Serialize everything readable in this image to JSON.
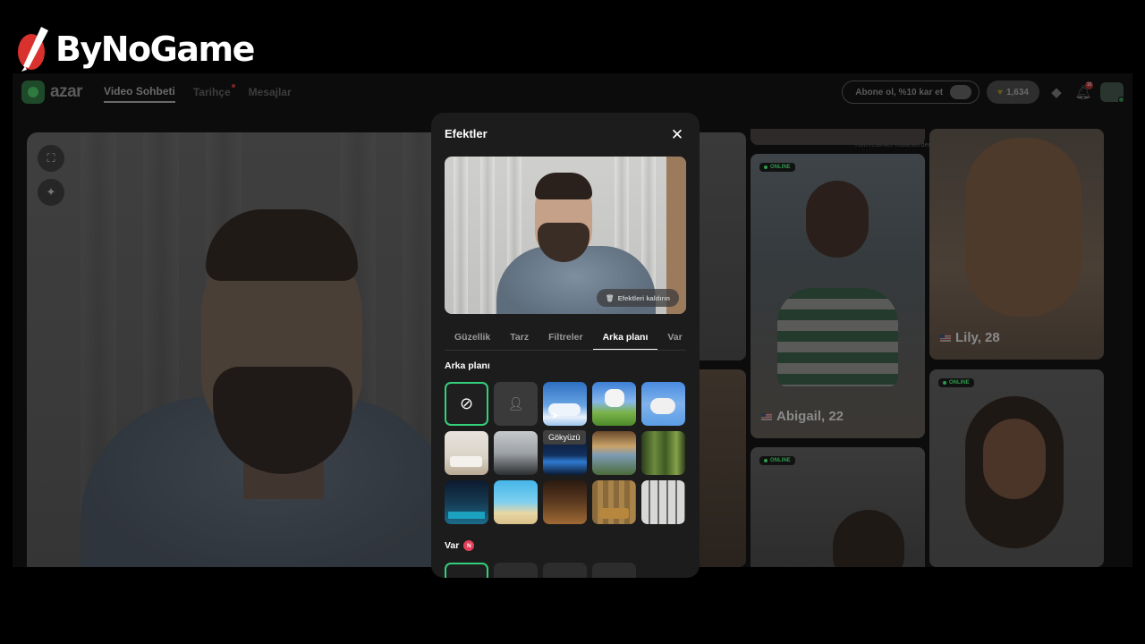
{
  "watermark": {
    "text": "ByNoGame"
  },
  "topbar": {
    "brand": "azar",
    "nav": [
      {
        "label": "Video Sohbeti",
        "active": true
      },
      {
        "label": "Tarihçe",
        "active": false,
        "dot": true
      },
      {
        "label": "Mesajlar",
        "active": false
      }
    ],
    "subscribe_label": "Abone ol, %10 kar et",
    "coins": "1,634",
    "bell_badge": "10"
  },
  "disclaimer": "Tüm resimler modellerden oluşmakta ve sadece gösterim amaçlı kullanılmaktadır",
  "cards": [
    {
      "name": "Lily, 28",
      "online_label": ""
    },
    {
      "name": "Abigail, 22",
      "online_label": "ONLINE"
    },
    {
      "name": "",
      "online_label": "ONLINE"
    },
    {
      "name": "",
      "online_label": "ONLINE"
    }
  ],
  "modal": {
    "title": "Efektler",
    "remove_effects_label": "Efektleri kaldırın",
    "tabs": [
      {
        "label": "Güzellik",
        "active": false
      },
      {
        "label": "Tarz",
        "active": false
      },
      {
        "label": "Filtreler",
        "active": false
      },
      {
        "label": "Arka planı",
        "active": true
      },
      {
        "label": "Var",
        "active": false
      }
    ],
    "section_background": "Arka planı",
    "section_var": "Var",
    "new_badge": "N",
    "tooltip": "Gökyüzü",
    "backgrounds": [
      {
        "name": "none",
        "selected": true
      },
      {
        "name": "blur",
        "selected": false
      },
      {
        "name": "Gökyüzü",
        "selected": false
      },
      {
        "name": "cat-meadow",
        "selected": false
      },
      {
        "name": "cat-sky",
        "selected": false
      },
      {
        "name": "white-room",
        "selected": false
      },
      {
        "name": "loft",
        "selected": false
      },
      {
        "name": "earth-space",
        "selected": false
      },
      {
        "name": "mountain-window",
        "selected": false
      },
      {
        "name": "forest",
        "selected": false
      },
      {
        "name": "game-room",
        "selected": false
      },
      {
        "name": "beach",
        "selected": false
      },
      {
        "name": "cabin",
        "selected": false
      },
      {
        "name": "sofa-wall",
        "selected": false
      },
      {
        "name": "city-window",
        "selected": false
      }
    ]
  },
  "colors": {
    "accent": "#33d07a",
    "modal_bg": "#1c1c1c",
    "online": "#2f9a4d",
    "new_badge": "#e2405a"
  }
}
